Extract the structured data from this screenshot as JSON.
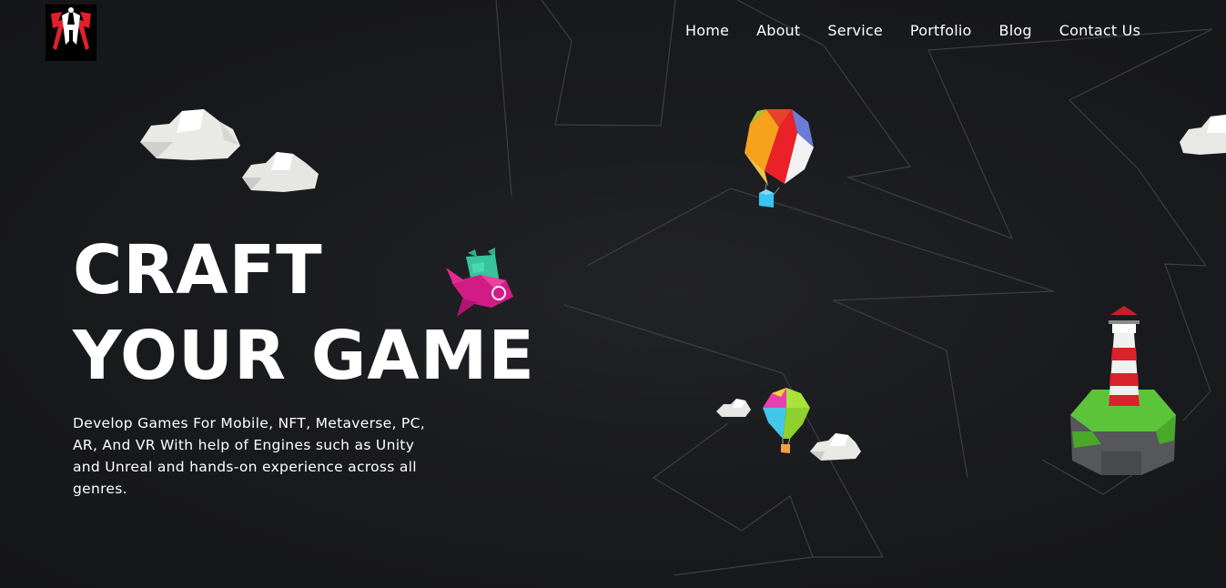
{
  "brand": {
    "logo_icon": "gaming-logo-icon"
  },
  "nav": {
    "items": [
      {
        "label": "Home"
      },
      {
        "label": "About"
      },
      {
        "label": "Service"
      },
      {
        "label": "Portfolio"
      },
      {
        "label": "Blog"
      },
      {
        "label": "Contact Us"
      }
    ]
  },
  "hero": {
    "title_line1": "CRAFT",
    "title_line2": "YOUR GAME",
    "description": "Develop Games For Mobile, NFT, Metaverse, PC, AR, And VR With help of Engines such as Unity and Unreal and hands-on experience across all genres."
  },
  "decorations": {
    "icons": [
      "cloud-icon",
      "hot-air-balloon-icon",
      "cat-airplane-icon",
      "lighthouse-island-icon"
    ]
  },
  "colors": {
    "background": "#1a1b1e",
    "text": "#ffffff",
    "line": "#3c3d41",
    "logo_red": "#e0202a"
  }
}
